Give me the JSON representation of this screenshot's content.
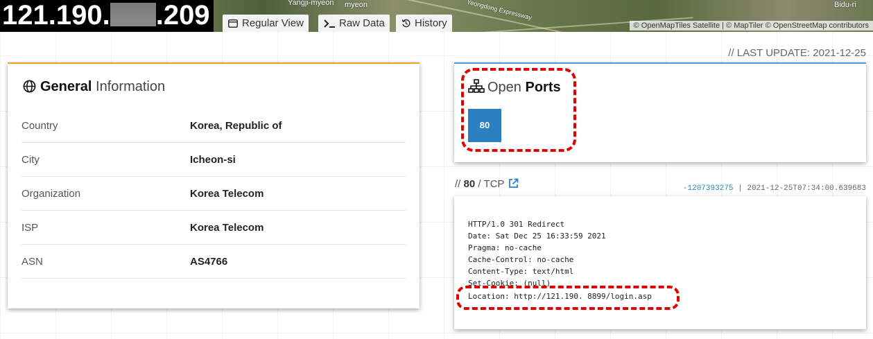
{
  "header": {
    "ip_part1": "121.190.",
    "ip_part2": ".209",
    "map_attribution": "© OpenMapTiles Satellite | © MapTiler © OpenStreetMap contributors",
    "map_places": [
      "Yangji-myeon",
      "myeon",
      "Yeongdong Expressway",
      "Bidu-ri"
    ]
  },
  "tabs": [
    {
      "label": "Regular View",
      "icon": "browser-window-icon"
    },
    {
      "label": "Raw Data",
      "icon": "terminal-icon"
    },
    {
      "label": "History",
      "icon": "history-icon"
    }
  ],
  "last_update": "// LAST UPDATE: 2021-12-25",
  "general": {
    "title_bold": "General",
    "title_light": "Information",
    "rows": [
      {
        "label": "Country",
        "value": "Korea, Republic of"
      },
      {
        "label": "City",
        "value": "Icheon-si"
      },
      {
        "label": "Organization",
        "value": "Korea Telecom"
      },
      {
        "label": "ISP",
        "value": "Korea Telecom"
      },
      {
        "label": "ASN",
        "value": "AS4766"
      }
    ]
  },
  "ports": {
    "title_light": "Open",
    "title_bold": "Ports",
    "list": [
      "80"
    ]
  },
  "service": {
    "slashes": "//",
    "port": "80",
    "protocol": "/ TCP",
    "hash": "-1207393275",
    "separator": "|",
    "timestamp": "2021-12-25T07:34:00.639683",
    "banner": [
      "HTTP/1.0 301 Redirect",
      "Date: Sat Dec 25 16:33:59 2021",
      "Pragma: no-cache",
      "Cache-Control: no-cache",
      "Content-Type: text/html",
      "Set-Cookie: (null)",
      "Location: http://121.190.        8899/login.asp"
    ]
  },
  "colors": {
    "general_accent": "#f0a020",
    "ports_accent": "#4a9be0",
    "port_chip": "#2c7fc0",
    "highlight": "#e00000"
  }
}
